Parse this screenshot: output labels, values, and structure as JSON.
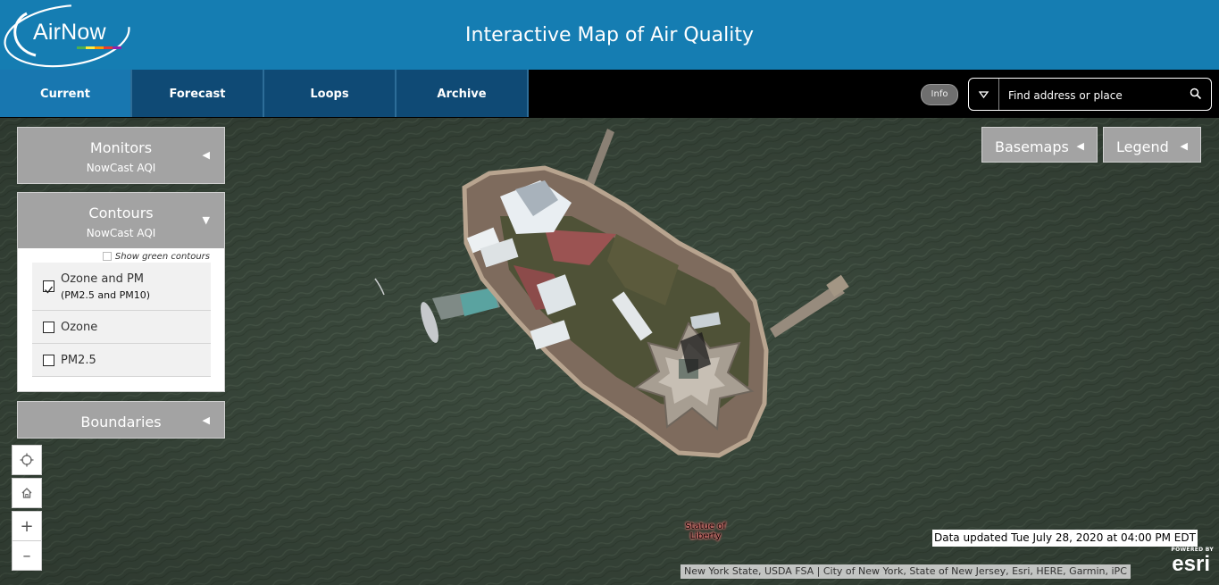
{
  "header": {
    "logo_text": "AirNow",
    "title": "Interactive Map of Air Quality"
  },
  "nav": {
    "tabs": [
      {
        "label": "Current",
        "active": true
      },
      {
        "label": "Forecast",
        "active": false
      },
      {
        "label": "Loops",
        "active": false
      },
      {
        "label": "Archive",
        "active": false
      }
    ],
    "info_label": "Info",
    "search": {
      "placeholder": "Find address or place",
      "value": ""
    }
  },
  "panels": {
    "monitors": {
      "title": "Monitors",
      "subtitle": "NowCast AQI",
      "expanded": false
    },
    "contours": {
      "title": "Contours",
      "subtitle": "NowCast AQI",
      "expanded": true,
      "green_toggle_label": "Show green contours",
      "green_toggle_checked": false,
      "options": [
        {
          "label": "Ozone and PM",
          "sublabel": "(PM2.5 and PM10)",
          "checked": true
        },
        {
          "label": "Ozone",
          "checked": false
        },
        {
          "label": "PM2.5",
          "checked": false
        }
      ]
    },
    "boundaries": {
      "title": "Boundaries",
      "expanded": false
    }
  },
  "map_controls": {
    "locate": "locate-icon",
    "home": "home-icon",
    "zoom_in": "+",
    "zoom_out": "–"
  },
  "right_buttons": {
    "basemaps": "Basemaps",
    "legend": "Legend"
  },
  "map": {
    "place_label_line1": "Statue of",
    "place_label_line2": "Liberty",
    "data_updated": "Data updated Tue July 28, 2020 at 04:00 PM EDT",
    "attribution": "New York State, USDA FSA | City of New York, State of New Jersey, Esri, HERE, Garmin, iPC",
    "esri_powered": "POWERED BY",
    "esri_word": "esri"
  },
  "colors": {
    "header_bg": "#157db2",
    "tab_active": "#1877b0",
    "tab_inactive": "#0f4a75",
    "panel_gray": "#a3a3a3",
    "water": "#3b4a3d"
  }
}
